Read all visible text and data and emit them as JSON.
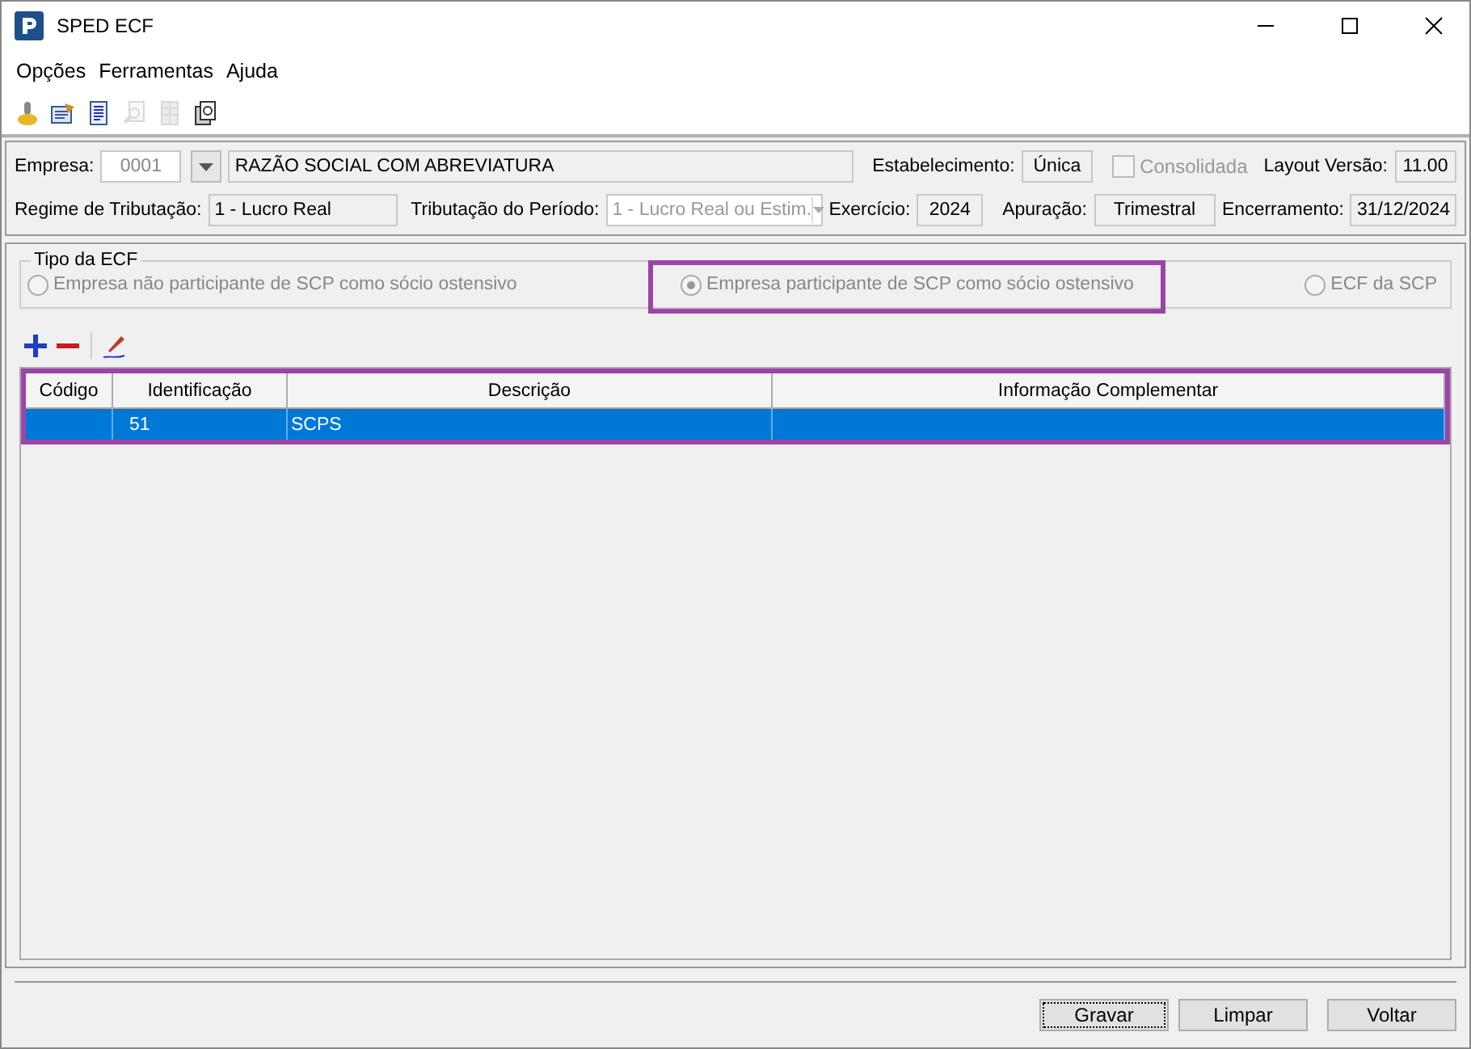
{
  "window": {
    "title": "SPED ECF"
  },
  "menu": [
    "Opções",
    "Ferramentas",
    "Ajuda"
  ],
  "toolbar": [
    {
      "disabled": false
    },
    {
      "disabled": false
    },
    {
      "disabled": false
    },
    {
      "disabled": true
    },
    {
      "disabled": true
    },
    {
      "disabled": false
    }
  ],
  "header": {
    "empresa_label": "Empresa:",
    "empresa_code": "0001",
    "empresa_name": "RAZÃO SOCIAL COM ABREVIATURA",
    "estabelecimento_label": "Estabelecimento:",
    "estabelecimento": "Única",
    "consolidada": {
      "label": "Consolidada",
      "checked": false,
      "disabled": true
    },
    "layout_label": "Layout Versão:",
    "layout": "11.00",
    "regime_label": "Regime de Tributação:",
    "regime": "1 - Lucro Real",
    "periodo_label": "Tributação do Período:",
    "periodo": "1 - Lucro Real ou Estim.",
    "exercicio_label": "Exercício:",
    "exercicio": "2024",
    "apuracao_label": "Apuração:",
    "apuracao": "Trimestral",
    "encerramento_label": "Encerramento:",
    "encerramento": "31/12/2024"
  },
  "tipo_ecf": {
    "legend": "Tipo da ECF",
    "options": [
      {
        "label": "Empresa não participante de SCP como sócio ostensivo",
        "selected": false,
        "disabled": true,
        "highlighted": false
      },
      {
        "label": "Empresa participante de SCP como sócio ostensivo",
        "selected": true,
        "disabled": true,
        "highlighted": true
      },
      {
        "label": "ECF da SCP",
        "selected": false,
        "disabled": true,
        "highlighted": false
      }
    ]
  },
  "table": {
    "highlighted": true,
    "columns": [
      "Código",
      "Identificação",
      "Descrição",
      "Informação Complementar"
    ],
    "rows": [
      {
        "cells": [
          "",
          "51",
          "SCPS",
          ""
        ],
        "selected": true
      }
    ]
  },
  "buttons": [
    "Gravar",
    "Limpar",
    "Voltar"
  ]
}
